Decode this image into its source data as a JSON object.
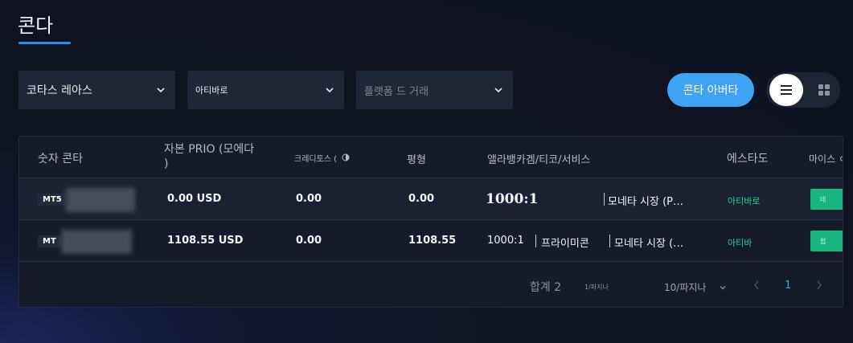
{
  "page": {
    "title": "콘다"
  },
  "filters": {
    "account_type": {
      "value": "코타스 레아스"
    },
    "status": {
      "value": "아티바로"
    },
    "platform": {
      "placeholder": "플랫폼 드 거래"
    }
  },
  "actions": {
    "open_account_label": "콘타 아버타"
  },
  "view_toggle": {
    "list_icon": "list-icon",
    "grid_icon": "grid-icon",
    "active": "list"
  },
  "table": {
    "headers": {
      "account_number": "숫자 콘타",
      "balance_line1": "자본 PRIO (모에다",
      "balance_line2": ")",
      "credits": "크레디토스 (",
      "equity": "평형",
      "leverage_service": "앨라뱅카겜/티코/서비스",
      "status": "에스타도",
      "more": "마이스 ㅇ"
    },
    "rows": [
      {
        "account_type": "MT5",
        "balance": "0.00 USD",
        "credits": "0.00",
        "equity": "0.00",
        "leverage": "1000:1",
        "service": "모네타 시장 (P…",
        "status": "아티바로",
        "action_label": "데"
      },
      {
        "account_type": "MT",
        "balance": "1108.55 USD",
        "credits": "0.00",
        "equity": "1108.55",
        "leverage": "1000:1",
        "tier": "프라이미콘",
        "service": "모네타 시장 (…",
        "status": "아티바",
        "action_label": "윕"
      }
    ]
  },
  "pagination": {
    "total": "합계 2",
    "per_page_small": "1/파지나",
    "page_size": "10/파지나",
    "current_page": "1"
  },
  "colors": {
    "accent": "#3ea3f5",
    "tab_underline": "#2f8cf0",
    "status_green": "#2fcf9a",
    "action_green": "#17b67f",
    "panel_bg": "#151b2b"
  }
}
